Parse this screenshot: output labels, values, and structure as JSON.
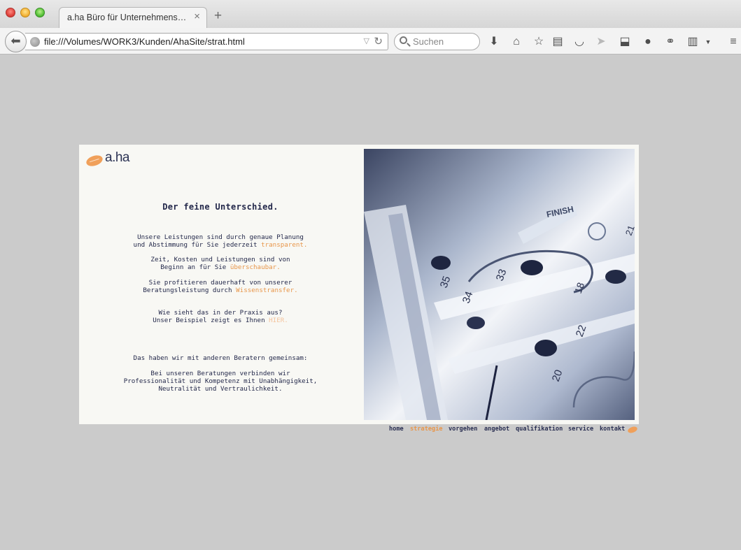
{
  "browser": {
    "tab_title": "a.ha Büro für Unternehmensfü…",
    "tab_close": "×",
    "new_tab": "+",
    "url": "file:///Volumes/WORK3/Kunden/AhaSite/strat.html",
    "search_placeholder": "Suchen",
    "toolbar_icons": [
      "download-icon",
      "home-icon",
      "bookmark-star-icon",
      "reading-list-icon",
      "pocket-icon",
      "send-icon",
      "download-manager-icon",
      "chat-icon",
      "share-icon",
      "clipboard-icon",
      "menu-icon"
    ]
  },
  "page": {
    "logo_text": "a.ha",
    "headline": "Der feine Unterschied.",
    "p1_line1": "Unsere Leistungen sind durch genaue Planung",
    "p1_line2": "und Abstimmung für Sie jederzeit ",
    "p1_hl": "transparent.",
    "p2_line1": "Zeit, Kosten und Leistungen sind von",
    "p2_line2": "Beginn an für Sie ",
    "p2_hl": "überschaubar.",
    "p3_line1": "Sie profitieren dauerhaft von unserer",
    "p3_line2": "Beratungsleistung durch ",
    "p3_hl": "Wissenstransfer.",
    "p4_line1": "Wie sieht das in der Praxis aus?",
    "p4_line2": "Unser Beispiel zeigt es Ihnen ",
    "p4_hl": "HIER.",
    "p5_line1": "Das haben wir mit anderen Beratern gemeinsam:",
    "p6_line1": "Bei unseren Beratungen verbinden wir",
    "p6_line2": "Professionalität und Kompetenz mit Unabhängigkeit,",
    "p6_line3": "Neutralität und Vertraulichkeit.",
    "photo_labels": [
      "FINISH",
      "35",
      "34",
      "33",
      "22",
      "20",
      "18",
      "21"
    ]
  },
  "nav": {
    "home": "home",
    "strategie": "strategie",
    "vorgehen": "vorgehen",
    "angebot": "angebot",
    "qualifikation": "qualifikation",
    "service": "service",
    "kontakt": "kontakt"
  },
  "colors": {
    "accent": "#e8964a",
    "text": "#23284a",
    "card_bg": "#f8f8f4",
    "page_bg": "#cbcbcb"
  }
}
